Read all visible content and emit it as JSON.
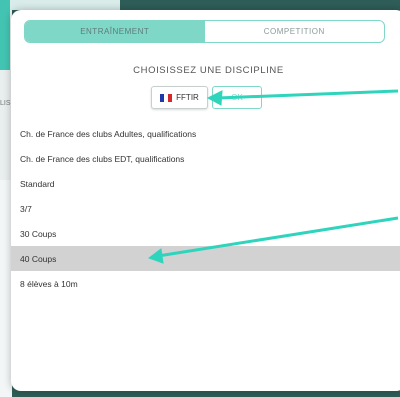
{
  "background": {
    "side_label": "LIS"
  },
  "tabs": [
    {
      "label": "ENTRAÎNEMENT",
      "active": true
    },
    {
      "label": "COMPETITION",
      "active": false
    }
  ],
  "title": "CHOISISSEZ UNE DISCIPLINE",
  "federation_button": {
    "label": "FFTIR",
    "flag": "france-flag-icon"
  },
  "ok_button": {
    "label": "OK"
  },
  "disciplines": [
    {
      "label": "Ch. de France des clubs Adultes, qualifications",
      "selected": false
    },
    {
      "label": "Ch. de France des clubs EDT, qualifications",
      "selected": false
    },
    {
      "label": "Standard",
      "selected": false
    },
    {
      "label": "3/7",
      "selected": false
    },
    {
      "label": "30 Coups",
      "selected": false
    },
    {
      "label": "40 Coups",
      "selected": true
    },
    {
      "label": "8 élèves à 10m",
      "selected": false
    }
  ],
  "colors": {
    "accent": "#7fd7c8",
    "arrow": "#2fd4bc",
    "selected_row": "#d2d2d2"
  }
}
